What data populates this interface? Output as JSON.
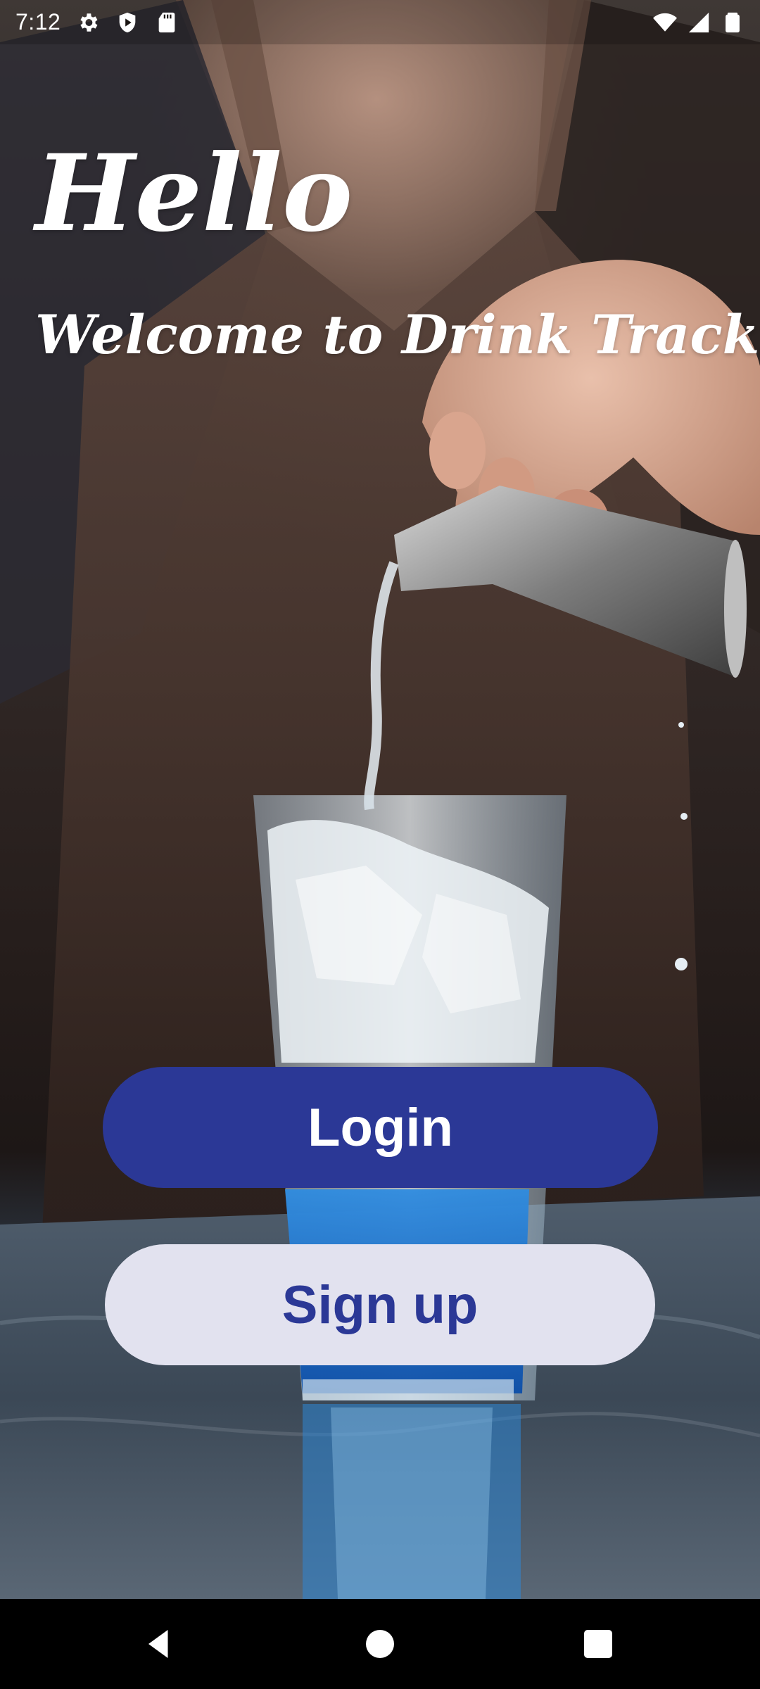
{
  "status_bar": {
    "time": "7:12",
    "left_icons": [
      "gear-icon",
      "play-shield-icon",
      "sd-card-icon"
    ],
    "right_icons": [
      "wifi-icon",
      "cell-signal-icon",
      "battery-icon"
    ]
  },
  "headline": {
    "greeting": "Hello",
    "welcome": "Welcome to Drink Trackr"
  },
  "actions": {
    "login_label": "Login",
    "signup_label": "Sign up"
  },
  "nav_bar": {
    "icons": [
      "back-icon",
      "home-icon",
      "recents-icon"
    ]
  },
  "colors": {
    "primary": "#2b3896",
    "secondary_button_bg": "#e2e2ef",
    "headline_text": "#ffffff"
  },
  "background_image": "bartender-pouring-blue-drink-photo"
}
